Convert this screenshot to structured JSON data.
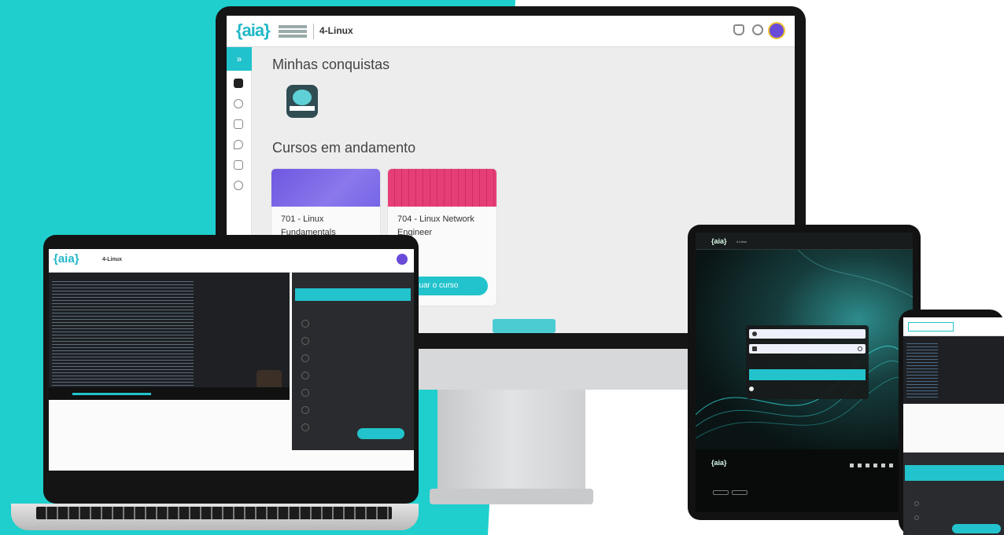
{
  "colors": {
    "accent": "#22c3cc",
    "background_teal": "#1ecfcd",
    "dark_panel": "#2a2b2e",
    "avatar": "#6a4bd8"
  },
  "imac": {
    "header": {
      "logo": "{aia}",
      "brand": "4-Linux",
      "icons": [
        "bell-icon",
        "gear-icon",
        "avatar"
      ]
    },
    "sidebar": {
      "toggle": "»",
      "icons": [
        "home-icon",
        "settings-icon",
        "certificate-icon",
        "chat-icon",
        "calendar-icon",
        "clock-icon"
      ]
    },
    "achievements_title": "Minhas conquistas",
    "courses_title": "Cursos em andamento",
    "courses": [
      {
        "title": "701 - Linux Fundamentals",
        "accent": "#7f6be8"
      },
      {
        "title": "704 - Linux Network Engineer",
        "accent": "#f27fae"
      }
    ],
    "continue_button": "Continuar o curso"
  },
  "laptop": {
    "header": {
      "logo": "{aia}",
      "brand": "4-Linux"
    },
    "panel_bar_label": "",
    "lesson_button": ""
  },
  "tablet": {
    "header": {
      "logo": "{aia}",
      "brand": "4-Linux"
    },
    "footer": {
      "logo": "{aia}"
    }
  },
  "phone": {
    "top_button": ""
  }
}
